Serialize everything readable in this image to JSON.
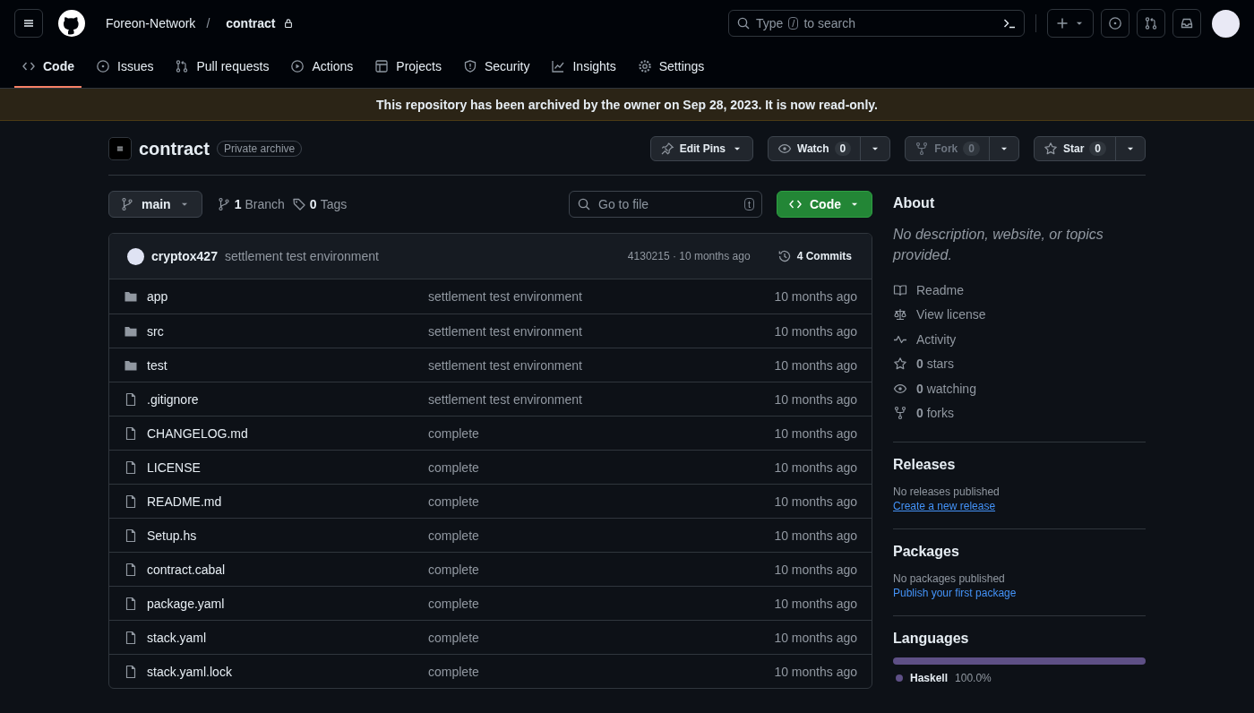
{
  "header": {
    "owner": "Foreon-Network",
    "separator": "/",
    "repo": "contract",
    "search": {
      "placeholder_before": "Type",
      "key": "/",
      "placeholder_after": "to search"
    }
  },
  "nav_tabs": [
    {
      "label": "Code",
      "selected": true
    },
    {
      "label": "Issues",
      "selected": false
    },
    {
      "label": "Pull requests",
      "selected": false
    },
    {
      "label": "Actions",
      "selected": false
    },
    {
      "label": "Projects",
      "selected": false
    },
    {
      "label": "Security",
      "selected": false
    },
    {
      "label": "Insights",
      "selected": false
    },
    {
      "label": "Settings",
      "selected": false
    }
  ],
  "banner": "This repository has been archived by the owner on Sep 28, 2023. It is now read-only.",
  "repo": {
    "name": "contract",
    "badge": "Private archive"
  },
  "repo_actions": [
    {
      "kind": "pins",
      "label": "Edit Pins",
      "disabled": false
    },
    {
      "kind": "watch",
      "label": "Watch",
      "count": "0",
      "disabled": false
    },
    {
      "kind": "fork",
      "label": "Fork",
      "count": "0",
      "disabled": true
    },
    {
      "kind": "star",
      "label": "Star",
      "count": "0",
      "disabled": false
    }
  ],
  "branch": {
    "name": "main",
    "branches_count": "1",
    "branches_label": "Branch",
    "tags_count": "0",
    "tags_label": "Tags"
  },
  "go_to_file": {
    "placeholder": "Go to file",
    "key": "t"
  },
  "code_button": "Code",
  "commit": {
    "author": "cryptox427",
    "message": "settlement test environment",
    "hash_time": "4130215 · 10 months ago",
    "commits_count": "4",
    "commits_label": "Commits"
  },
  "files": [
    {
      "kind": "folder",
      "name": "app",
      "message": "settlement test environment",
      "time": "10 months ago"
    },
    {
      "kind": "folder",
      "name": "src",
      "message": "settlement test environment",
      "time": "10 months ago"
    },
    {
      "kind": "folder",
      "name": "test",
      "message": "settlement test environment",
      "time": "10 months ago"
    },
    {
      "kind": "file",
      "name": ".gitignore",
      "message": "settlement test environment",
      "time": "10 months ago"
    },
    {
      "kind": "file",
      "name": "CHANGELOG.md",
      "message": "complete",
      "time": "10 months ago"
    },
    {
      "kind": "file",
      "name": "LICENSE",
      "message": "complete",
      "time": "10 months ago"
    },
    {
      "kind": "file",
      "name": "README.md",
      "message": "complete",
      "time": "10 months ago"
    },
    {
      "kind": "file",
      "name": "Setup.hs",
      "message": "complete",
      "time": "10 months ago"
    },
    {
      "kind": "file",
      "name": "contract.cabal",
      "message": "complete",
      "time": "10 months ago"
    },
    {
      "kind": "file",
      "name": "package.yaml",
      "message": "complete",
      "time": "10 months ago"
    },
    {
      "kind": "file",
      "name": "stack.yaml",
      "message": "complete",
      "time": "10 months ago"
    },
    {
      "kind": "file",
      "name": "stack.yaml.lock",
      "message": "complete",
      "time": "10 months ago"
    }
  ],
  "about": {
    "title": "About",
    "description": "No description, website, or topics provided.",
    "items": [
      {
        "kind": "readme",
        "label": "Readme"
      },
      {
        "kind": "license",
        "label": "View license"
      },
      {
        "kind": "activity",
        "label": "Activity"
      },
      {
        "kind": "stars",
        "count": "0",
        "label": "stars"
      },
      {
        "kind": "watching",
        "count": "0",
        "label": "watching"
      },
      {
        "kind": "forks",
        "count": "0",
        "label": "forks"
      }
    ]
  },
  "releases": {
    "title": "Releases",
    "note": "No releases published",
    "link": "Create a new release"
  },
  "packages": {
    "title": "Packages",
    "note": "No packages published",
    "link": "Publish your first package"
  },
  "languages": {
    "title": "Languages",
    "items": [
      {
        "name": "Haskell",
        "percent": "100.0%",
        "color": "#5e5086",
        "level": 1.0
      }
    ]
  }
}
